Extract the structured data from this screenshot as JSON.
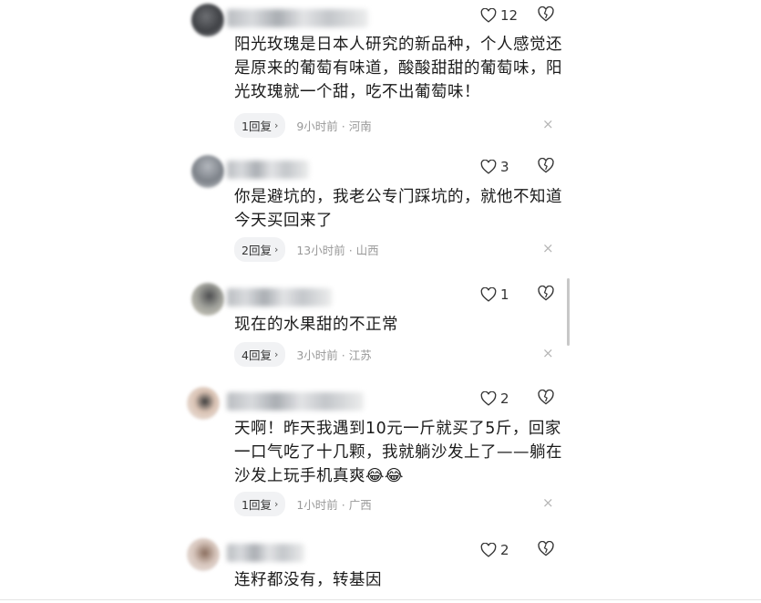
{
  "comments": [
    {
      "likes": "12",
      "text": "阳光玫瑰是日本人研究的新品种，个人感觉还是原来的葡萄有味道，酸酸甜甜的葡萄味，阳光玫瑰就一个甜，吃不出葡萄味！",
      "replies": "1回复",
      "time_location": "9小时前 · 河南"
    },
    {
      "likes": "3",
      "text": "你是避坑的，我老公专门踩坑的，就他不知道今天买回来了",
      "replies": "2回复",
      "time_location": "13小时前 · 山西"
    },
    {
      "likes": "1",
      "text": "现在的水果甜的不正常",
      "replies": "4回复",
      "time_location": "3小时前 · 江苏"
    },
    {
      "likes": "2",
      "text": "天啊！昨天我遇到10元一斤就买了5斤，回家一口气吃了十几颗，我就躺沙发上了——躺在沙发上玩手机真爽😂😂",
      "replies": "1回复",
      "time_location": "1小时前 · 广西"
    },
    {
      "likes": "2",
      "text": "连籽都没有，转基因"
    }
  ],
  "icons": {
    "like": "heart-outline-icon",
    "dislike": "broken-heart-icon",
    "close": "close-icon",
    "reply_chevron": "chevron-right-icon",
    "close_glyph": "×",
    "chevron_glyph": "›"
  },
  "colors": {
    "text": "#1b1b1b",
    "meta": "#999999",
    "pill_bg": "#f1f2f4"
  }
}
